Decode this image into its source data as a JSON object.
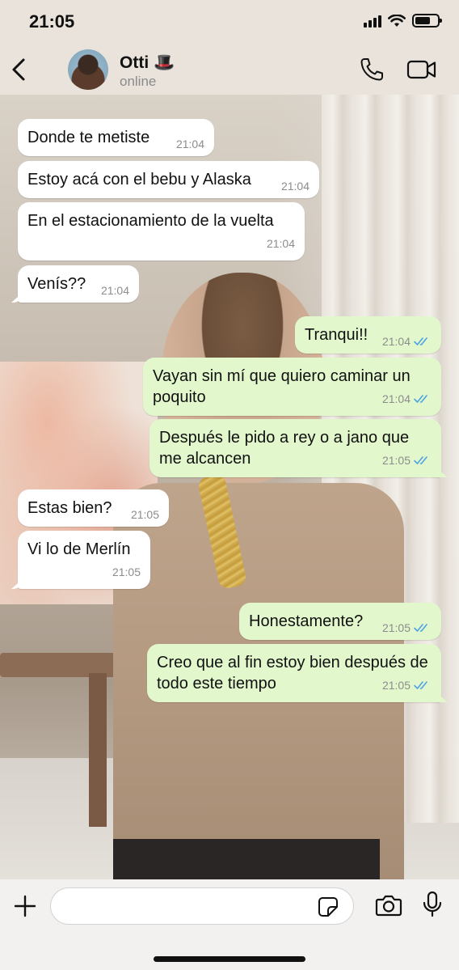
{
  "status_bar": {
    "time": "21:05"
  },
  "header": {
    "contact_name": "Otti",
    "contact_emoji": "🎩",
    "contact_status": "online"
  },
  "messages": [
    {
      "side": "in",
      "text": "Donde te metiste",
      "time": "21:04"
    },
    {
      "side": "in",
      "text": "Estoy acá con el bebu y Alaska",
      "time": "21:04"
    },
    {
      "side": "in",
      "text": "En el estacionamiento de la vuelta",
      "time": "21:04"
    },
    {
      "side": "in",
      "text": "Venís??",
      "time": "21:04"
    },
    {
      "side": "out",
      "text": "Tranqui!!",
      "time": "21:04",
      "read": true
    },
    {
      "side": "out",
      "text": "Vayan sin mí que quiero caminar un poquito",
      "time": "21:04",
      "read": true
    },
    {
      "side": "out",
      "text": "Después le pido a rey o a jano que me alcancen",
      "time": "21:05",
      "read": true
    },
    {
      "side": "in",
      "text": "Estas bien?",
      "time": "21:05"
    },
    {
      "side": "in",
      "text": "Vi lo de Merlín",
      "time": "21:05"
    },
    {
      "side": "out",
      "text": "Honestamente?",
      "time": "21:05",
      "read": true
    },
    {
      "side": "out",
      "text": "Creo que al fin estoy bien después de todo este tiempo",
      "time": "21:05",
      "read": true
    }
  ],
  "input": {
    "placeholder": ""
  },
  "colors": {
    "incoming_bubble": "#ffffff",
    "outgoing_bubble": "#e2f8cc",
    "read_ticks": "#4fa3e0",
    "header_bg": "#e9e3dc"
  },
  "icons": {
    "back": "chevron-left-icon",
    "call": "phone-icon",
    "video": "video-camera-icon",
    "attach": "plus-icon",
    "sticker": "sticker-icon",
    "camera": "camera-icon",
    "mic": "microphone-icon"
  }
}
